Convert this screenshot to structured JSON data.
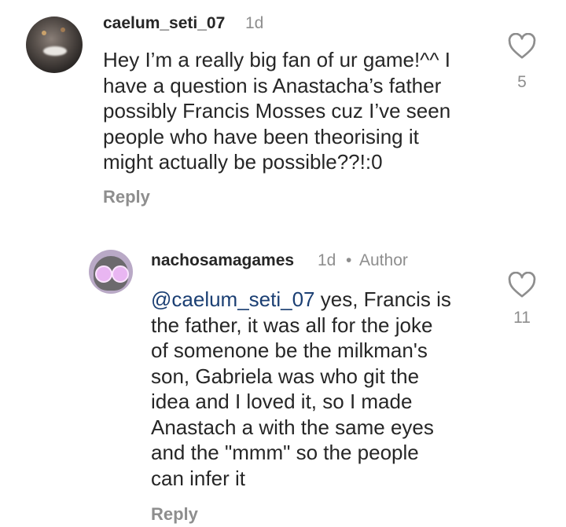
{
  "comments": [
    {
      "username": "caelum_seti_07",
      "time": "1d",
      "text": "Hey I’m a really big fan of ur game!^^ I\nhave a question is Anastacha’s father\npossibly Francis Mosses cuz I’ve seen\npeople who have been theorising it\nmight actually be possible??!:0",
      "reply_label": "Reply",
      "likes": "5"
    },
    {
      "username": "nachosamagames",
      "time": "1d",
      "separator": "•",
      "badge": "Author",
      "mention": "@caelum_seti_07",
      "text": " yes, Francis is\nthe father, it was all for the joke\nof somenone be the milkman's\nson, Gabriela was who git the\nidea and I loved it, so I made\nAnastach a with the same eyes\nand the \"mmm\" so the people\ncan infer it",
      "reply_label": "Reply",
      "likes": "11"
    }
  ],
  "icons": {
    "like": "heart-outline-icon"
  },
  "colors": {
    "text": "#262626",
    "secondary": "#8e8e8e",
    "mention": "#1b3f73"
  }
}
